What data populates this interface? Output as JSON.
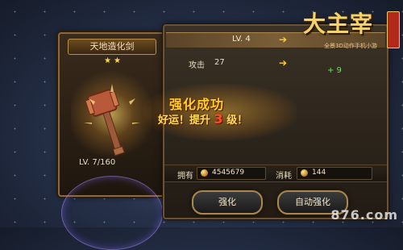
{
  "item_panel": {
    "title": "天地造化剑",
    "stars": "★★",
    "level_text": "LV. 7/160"
  },
  "info_panel": {
    "level_text": "LV. 4",
    "attack_label": "攻击",
    "attack_value": "27",
    "attack_gain": "+ 9",
    "own_label": "拥有",
    "own_value": "4545679",
    "cost_label": "消耗",
    "cost_value": "144"
  },
  "buttons": {
    "upgrade": "强化",
    "auto_upgrade": "自动强化"
  },
  "success": {
    "title": "强化成功",
    "line_prefix": "好运！提升",
    "level": "3",
    "line_suffix": "级！"
  },
  "logo": {
    "title": "大主宰",
    "tag": "全景3D动作手机小游"
  },
  "watermark": "876.com",
  "colors": {
    "accent": "#ffcf2e",
    "gain": "#6fe06a",
    "panel_border": "#8a6a3c"
  }
}
